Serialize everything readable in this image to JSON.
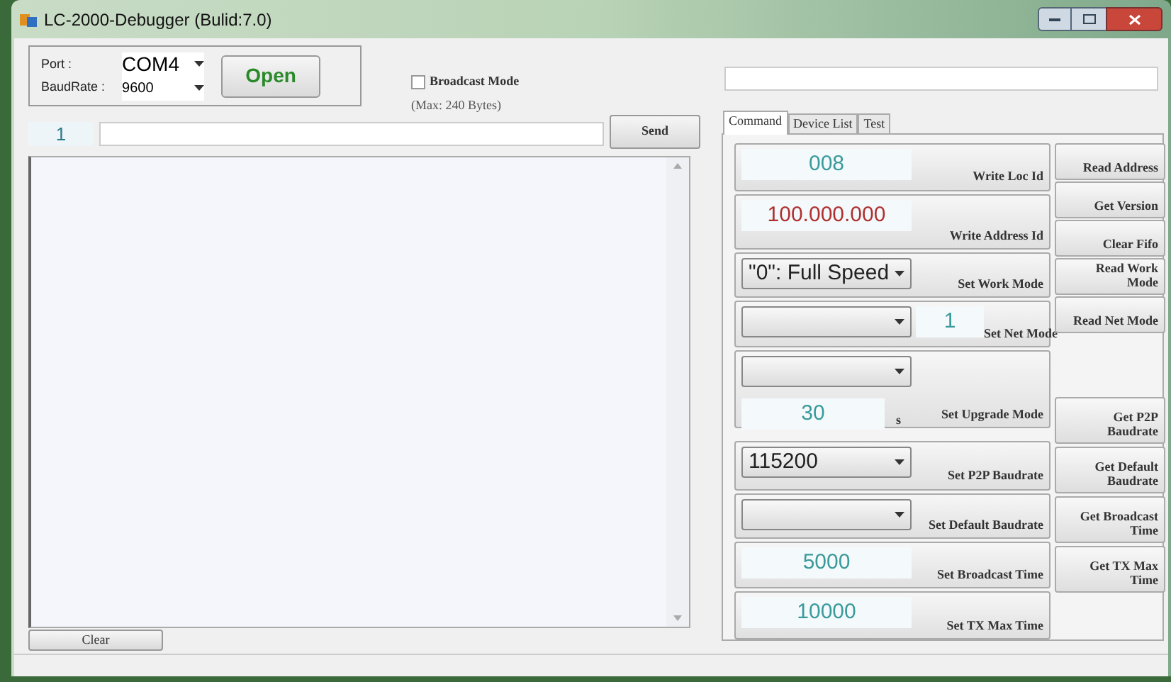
{
  "window": {
    "title": "LC-2000-Debugger (Bulid:7.0)"
  },
  "connection": {
    "port_label": "Port :",
    "port": "COM4",
    "baud_label": "BaudRate :",
    "baud": "9600",
    "open_button": "Open"
  },
  "broadcast": {
    "label": "Broadcast Mode",
    "checked": false,
    "note": "(Max: 240 Bytes)"
  },
  "send": {
    "index": "1",
    "send_button": "Send"
  },
  "clear_button": "Clear",
  "tabs": [
    {
      "label": "Command",
      "selected": true
    },
    {
      "label": "Device List",
      "selected": false
    },
    {
      "label": "Test",
      "selected": false
    }
  ],
  "commands": [
    {
      "kind": "input",
      "value": "008",
      "color": "#3a9a9a",
      "label": "Write Loc Id"
    },
    {
      "kind": "input",
      "value": "100.000.000",
      "color": "#b03030",
      "label": "Write Address Id"
    },
    {
      "kind": "select",
      "value": "\"0\": Full Speed",
      "label": "Set Work Mode"
    },
    {
      "kind": "select_input",
      "input": "1",
      "color": "#3a9a9a",
      "label": "Set Net Mode"
    },
    {
      "kind": "select_timer",
      "input": "30",
      "color": "#3a9a9a",
      "unit": "s",
      "label": "Set Upgrade Mode"
    },
    {
      "kind": "select",
      "value": "115200",
      "label": "Set P2P Baudrate"
    },
    {
      "kind": "select",
      "label": "Set Default Baudrate"
    },
    {
      "kind": "input",
      "value": "5000",
      "color": "#3a9a9a",
      "label": "Set Broadcast Time"
    },
    {
      "kind": "input",
      "value": "10000",
      "color": "#3a9a9a",
      "label": "Set TX Max Time"
    }
  ],
  "buttons_top": [
    "Read Address",
    "Get Version",
    "Clear Fifo",
    "Read Work Mode",
    "Read Net Mode"
  ],
  "buttons_bottom": [
    "Get P2P Baudrate",
    "Get Default Baudrate",
    "Get Broadcast Time",
    "Get TX Max Time"
  ]
}
